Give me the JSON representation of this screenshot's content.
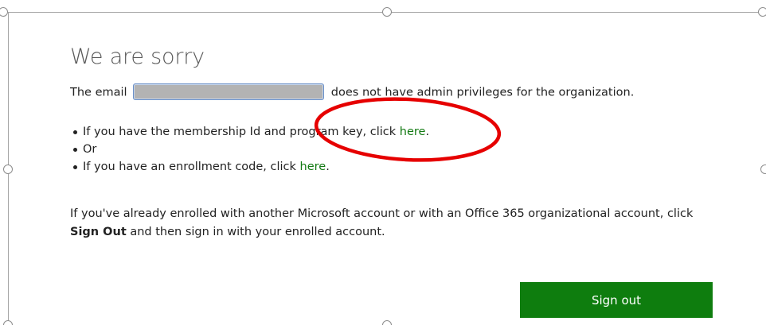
{
  "dialog": {
    "title": "We are sorry",
    "email_prefix": "The email",
    "email_value": "",
    "email_suffix": "does not have admin privileges for the organization.",
    "options": [
      {
        "text": "If you have the membership Id and program key, click ",
        "link": "here",
        "tail": "."
      },
      {
        "text": "Or",
        "link": "",
        "tail": ""
      },
      {
        "text": "If you have an enrollment code, click ",
        "link": "here",
        "tail": "."
      }
    ],
    "note_part1": "If you've already enrolled with another Microsoft account or with an Office 365 organizational account, click ",
    "note_bold": "Sign Out",
    "note_part2": " and then sign in with your enrolled account.",
    "signout_label": "Sign out"
  },
  "colors": {
    "link": "#137a13",
    "button": "#0e7d0e",
    "annotation": "#e60000",
    "email_box": "#b3b3b3"
  }
}
